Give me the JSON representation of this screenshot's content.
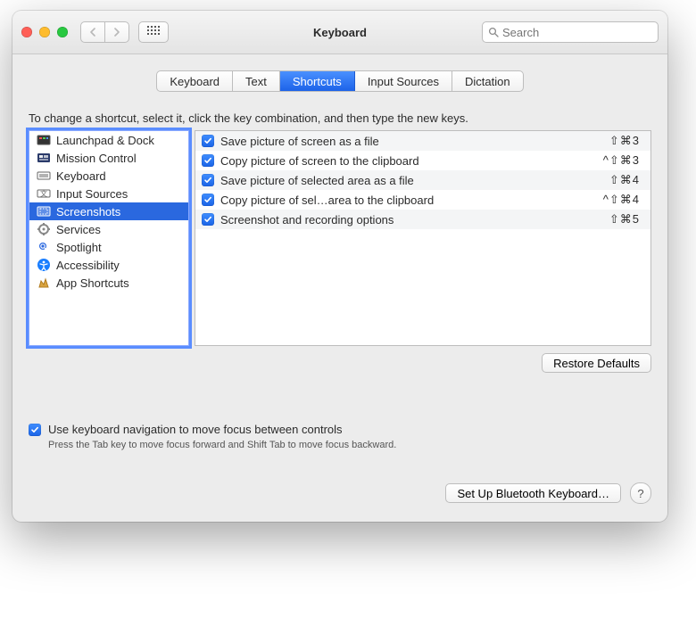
{
  "window": {
    "title": "Keyboard"
  },
  "search": {
    "placeholder": "Search"
  },
  "tabs": [
    {
      "label": "Keyboard",
      "active": false
    },
    {
      "label": "Text",
      "active": false
    },
    {
      "label": "Shortcuts",
      "active": true
    },
    {
      "label": "Input Sources",
      "active": false
    },
    {
      "label": "Dictation",
      "active": false
    }
  ],
  "hint": "To change a shortcut, select it, click the key combination, and then type the new keys.",
  "categories": [
    {
      "label": "Launchpad & Dock",
      "icon": "launchpad",
      "selected": false
    },
    {
      "label": "Mission Control",
      "icon": "mission-control",
      "selected": false
    },
    {
      "label": "Keyboard",
      "icon": "keyboard",
      "selected": false
    },
    {
      "label": "Input Sources",
      "icon": "input-sources",
      "selected": false
    },
    {
      "label": "Screenshots",
      "icon": "screenshots",
      "selected": true
    },
    {
      "label": "Services",
      "icon": "services",
      "selected": false
    },
    {
      "label": "Spotlight",
      "icon": "spotlight",
      "selected": false
    },
    {
      "label": "Accessibility",
      "icon": "accessibility",
      "selected": false
    },
    {
      "label": "App Shortcuts",
      "icon": "app-shortcuts",
      "selected": false
    }
  ],
  "shortcuts": [
    {
      "enabled": true,
      "label": "Save picture of screen as a file",
      "keys": "⇧⌘3"
    },
    {
      "enabled": true,
      "label": "Copy picture of screen to the clipboard",
      "keys": "^⇧⌘3"
    },
    {
      "enabled": true,
      "label": "Save picture of selected area as a file",
      "keys": "⇧⌘4"
    },
    {
      "enabled": true,
      "label": "Copy picture of sel…area to the clipboard",
      "keys": "^⇧⌘4"
    },
    {
      "enabled": true,
      "label": "Screenshot and recording options",
      "keys": "⇧⌘5"
    }
  ],
  "restore_label": "Restore Defaults",
  "kbnav": {
    "enabled": true,
    "label": "Use keyboard navigation to move focus between controls",
    "help": "Press the Tab key to move focus forward and Shift Tab to move focus backward."
  },
  "footer": {
    "bluetooth_label": "Set Up Bluetooth Keyboard…",
    "help_label": "?"
  }
}
